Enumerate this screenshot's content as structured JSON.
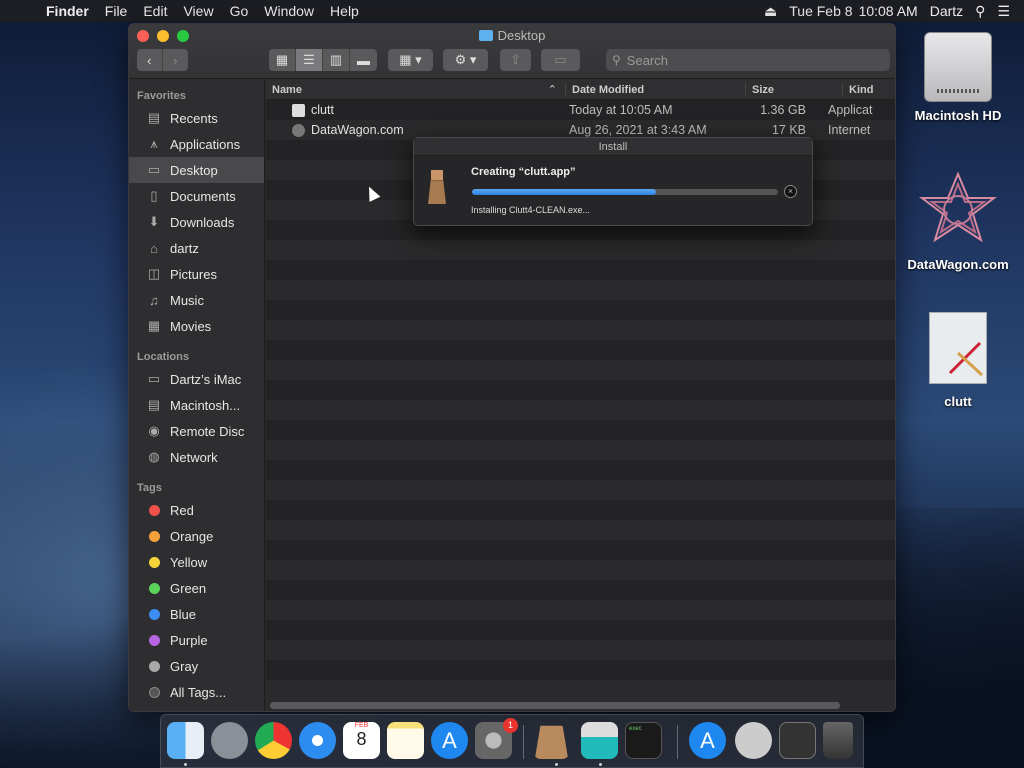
{
  "menubar": {
    "app": "Finder",
    "items": [
      "File",
      "Edit",
      "View",
      "Go",
      "Window",
      "Help"
    ],
    "date": "Tue Feb 8",
    "time": "10:08 AM",
    "user": "Dartz"
  },
  "window": {
    "title": "Desktop",
    "search_placeholder": "Search",
    "columns": {
      "name": "Name",
      "date": "Date Modified",
      "size": "Size",
      "kind": "Kind"
    },
    "files": [
      {
        "name": "clutt",
        "date": "Today at 10:05 AM",
        "size": "1.36 GB",
        "kind": "Applicat"
      },
      {
        "name": "DataWagon.com",
        "date": "Aug 26, 2021 at 3:43 AM",
        "size": "17 KB",
        "kind": "Internet"
      }
    ]
  },
  "sidebar": {
    "favorites_header": "Favorites",
    "favorites": [
      "Recents",
      "Applications",
      "Desktop",
      "Documents",
      "Downloads",
      "dartz",
      "Pictures",
      "Music",
      "Movies"
    ],
    "locations_header": "Locations",
    "locations": [
      "Dartz’s iMac",
      "Macintosh...",
      "Remote Disc",
      "Network"
    ],
    "tags_header": "Tags",
    "tags": [
      {
        "label": "Red",
        "color": "#f0524a"
      },
      {
        "label": "Orange",
        "color": "#f5a03a"
      },
      {
        "label": "Yellow",
        "color": "#f5d33a"
      },
      {
        "label": "Green",
        "color": "#5bd25a"
      },
      {
        "label": "Blue",
        "color": "#3c8ef5"
      },
      {
        "label": "Purple",
        "color": "#b765e0"
      },
      {
        "label": "Gray",
        "color": "#a8a8a8"
      }
    ],
    "all_tags": "All Tags..."
  },
  "dialog": {
    "title": "Install",
    "heading": "Creating “clutt.app”",
    "status": "Installing Clutt4-CLEAN.exe...",
    "progress": 0.6
  },
  "desktop_icons": [
    "Macintosh HD",
    "DataWagon.com",
    "clutt"
  ],
  "dock": {
    "calendar_day": "8",
    "calendar_month": "FEB",
    "settings_badge": "1",
    "terminal_text": "exec"
  }
}
